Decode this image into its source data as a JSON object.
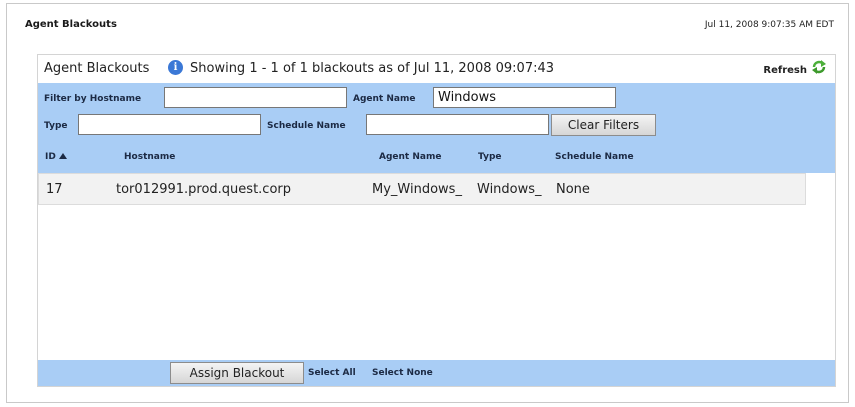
{
  "page": {
    "title": "Agent Blackouts",
    "timestamp": "Jul 11, 2008 9:07:35 AM EDT"
  },
  "panel": {
    "title": "Agent Blackouts",
    "showing": "Showing 1 - 1  of 1 blackouts as of Jul 11, 2008 09:07:43",
    "refresh_label": "Refresh",
    "info_icon": "info-icon",
    "refresh_icon": "refresh-icon"
  },
  "filters": {
    "hostname_label": "Filter by Hostname",
    "hostname_value": "",
    "agent_name_label": "Agent Name",
    "agent_name_value": "Windows",
    "type_label": "Type",
    "type_value": "",
    "schedule_name_label": "Schedule Name",
    "schedule_name_value": "",
    "clear_button": "Clear Filters"
  },
  "table": {
    "columns": [
      "ID",
      "Hostname",
      "Agent Name",
      "Type",
      "Schedule Name"
    ],
    "sort_column": "ID",
    "sort_direction": "ascending",
    "rows": [
      [
        "17",
        "tor012991.prod.quest.corp",
        "My_Windows_",
        "Windows_",
        "None"
      ]
    ]
  },
  "footer": {
    "assign_button": "Assign Blackout",
    "select_all": "Select All",
    "select_none": "Select None"
  },
  "colors": {
    "accent": "#a9cdf5",
    "info_icon": "#3b78d6",
    "refresh_icon": "#4caf3a"
  }
}
